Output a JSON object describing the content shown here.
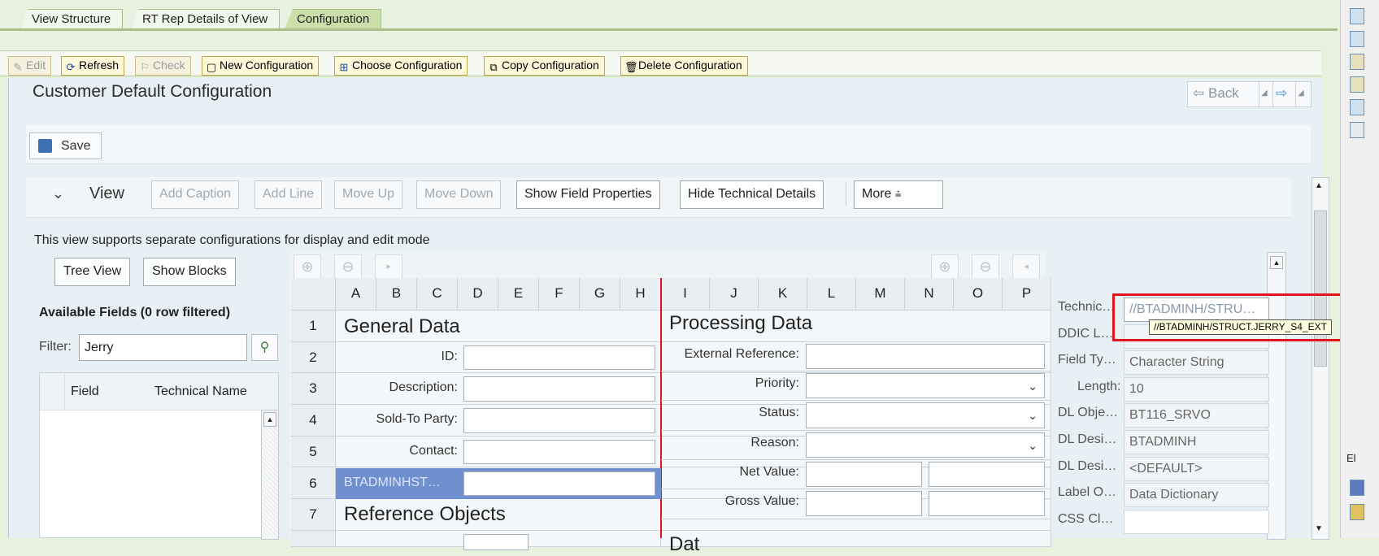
{
  "tabs": [
    {
      "label": "View Structure",
      "active": false
    },
    {
      "label": "RT Rep Details of View",
      "active": false
    },
    {
      "label": "Configuration",
      "active": true
    }
  ],
  "toolbar": {
    "edit": "Edit",
    "refresh": "Refresh",
    "check": "Check",
    "new_config": "New Configuration",
    "choose_config": "Choose Configuration",
    "copy_config": "Copy Configuration",
    "delete_config": "Delete Configuration"
  },
  "page": {
    "title": "Customer Default Configuration",
    "back": "Back",
    "save": "Save"
  },
  "viewbar": {
    "label": "View",
    "add_caption": "Add Caption",
    "add_line": "Add Line",
    "move_up": "Move Up",
    "move_down": "Move Down",
    "show_field_properties": "Show Field Properties",
    "hide_technical_details": "Hide Technical Details",
    "more": "More"
  },
  "info": "This view supports separate configurations for display and edit mode",
  "left": {
    "tree_view": "Tree View",
    "show_blocks": "Show Blocks",
    "available_fields": "Available Fields (0 row filtered)",
    "filter_label": "Filter:",
    "filter_value": "Jerry",
    "col_field": "Field",
    "col_technical": "Technical Name"
  },
  "grid": {
    "columns": [
      "A",
      "B",
      "C",
      "D",
      "E",
      "F",
      "G",
      "H",
      "I",
      "J",
      "K",
      "L",
      "M",
      "N",
      "O",
      "P"
    ],
    "rows": [
      "1",
      "2",
      "3",
      "4",
      "5",
      "6",
      "7"
    ],
    "general_data": "General Data",
    "processing_data": "Processing Data",
    "reference_objects": "Reference Objects",
    "left_fields": [
      "ID:",
      "Description:",
      "Sold-To Party:",
      "Contact:"
    ],
    "selected_field": "BTADMINHST…",
    "right_fields": [
      "External Reference:",
      "Priority:",
      "Status:",
      "Reason:",
      "Net Value:",
      "Gross Value:"
    ],
    "dates_partial": "Dat"
  },
  "properties": [
    {
      "label": "Technic…",
      "value": "//BTADMINH/STRU…"
    },
    {
      "label": "DDIC L…",
      "value": ""
    },
    {
      "label": "Field Ty…",
      "value": "Character String"
    },
    {
      "label": "Length:",
      "value": "10"
    },
    {
      "label": "DL Obje…",
      "value": "BT116_SRVO"
    },
    {
      "label": "DL Desi…",
      "value": "BTADMINH"
    },
    {
      "label": "DL Desi…",
      "value": "<DEFAULT>"
    },
    {
      "label": "Label O…",
      "value": "Data Dictionary"
    },
    {
      "label": "CSS Cl…",
      "value": ""
    }
  ],
  "tooltip": "//BTADMINH/STRUCT.JERRY_S4_EXT",
  "side_label": "El"
}
